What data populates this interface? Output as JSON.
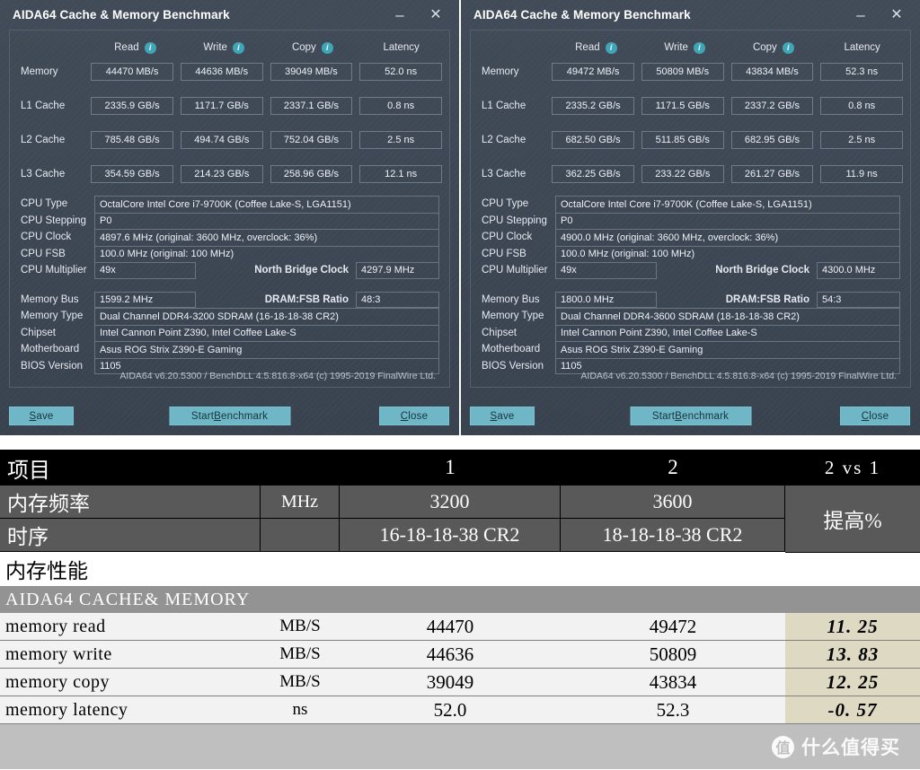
{
  "windows": [
    {
      "title": "AIDA64 Cache & Memory Benchmark",
      "minimize": "–",
      "close": "✕",
      "columns": [
        "Read",
        "Write",
        "Copy",
        "Latency"
      ],
      "rows": [
        {
          "label": "Memory",
          "read": "44470 MB/s",
          "write": "44636 MB/s",
          "copy": "39049 MB/s",
          "latency": "52.0 ns"
        },
        {
          "label": "L1 Cache",
          "read": "2335.9 GB/s",
          "write": "1171.7 GB/s",
          "copy": "2337.1 GB/s",
          "latency": "0.8 ns"
        },
        {
          "label": "L2 Cache",
          "read": "785.48 GB/s",
          "write": "494.74 GB/s",
          "copy": "752.04 GB/s",
          "latency": "2.5 ns"
        },
        {
          "label": "L3 Cache",
          "read": "354.59 GB/s",
          "write": "214.23 GB/s",
          "copy": "258.96 GB/s",
          "latency": "12.1 ns"
        }
      ],
      "info": {
        "cpu_type_label": "CPU Type",
        "cpu_type_value": "OctalCore Intel Core i7-9700K  (Coffee Lake-S, LGA1151)",
        "cpu_stepping_label": "CPU Stepping",
        "cpu_stepping_value": "P0",
        "cpu_clock_label": "CPU Clock",
        "cpu_clock_value": "4897.6 MHz  (original: 3600 MHz, overclock: 36%)",
        "cpu_fsb_label": "CPU FSB",
        "cpu_fsb_value": "100.0 MHz  (original: 100 MHz)",
        "cpu_multiplier_label": "CPU Multiplier",
        "cpu_multiplier_value": "49x",
        "north_bridge_label": "North Bridge Clock",
        "north_bridge_value": "4297.9 MHz",
        "memory_bus_label": "Memory Bus",
        "memory_bus_value": "1599.2 MHz",
        "dram_fsb_label": "DRAM:FSB Ratio",
        "dram_fsb_value": "48:3",
        "memory_type_label": "Memory Type",
        "memory_type_value": "Dual Channel DDR4-3200 SDRAM  (16-18-18-38 CR2)",
        "chipset_label": "Chipset",
        "chipset_value": "Intel Cannon Point Z390, Intel Coffee Lake-S",
        "motherboard_label": "Motherboard",
        "motherboard_value": "Asus ROG Strix Z390-E Gaming",
        "bios_label": "BIOS Version",
        "bios_value": "1105"
      },
      "footer": "AIDA64 v6.20.5300 / BenchDLL 4.5.816.8-x64  (c) 1995-2019 FinalWire Ltd.",
      "buttons": {
        "save_a": "S",
        "save_b": "ave",
        "start_a": "Start ",
        "start_b": "B",
        "start_c": "enchmark",
        "close_a": "C",
        "close_b": "lose"
      }
    },
    {
      "title": "AIDA64 Cache & Memory Benchmark",
      "minimize": "–",
      "close": "✕",
      "columns": [
        "Read",
        "Write",
        "Copy",
        "Latency"
      ],
      "rows": [
        {
          "label": "Memory",
          "read": "49472 MB/s",
          "write": "50809 MB/s",
          "copy": "43834 MB/s",
          "latency": "52.3 ns"
        },
        {
          "label": "L1 Cache",
          "read": "2335.2 GB/s",
          "write": "1171.5 GB/s",
          "copy": "2337.2 GB/s",
          "latency": "0.8 ns"
        },
        {
          "label": "L2 Cache",
          "read": "682.50 GB/s",
          "write": "511.85 GB/s",
          "copy": "682.95 GB/s",
          "latency": "2.5 ns"
        },
        {
          "label": "L3 Cache",
          "read": "362.25 GB/s",
          "write": "233.22 GB/s",
          "copy": "261.27 GB/s",
          "latency": "11.9 ns"
        }
      ],
      "info": {
        "cpu_type_label": "CPU Type",
        "cpu_type_value": "OctalCore Intel Core i7-9700K  (Coffee Lake-S, LGA1151)",
        "cpu_stepping_label": "CPU Stepping",
        "cpu_stepping_value": "P0",
        "cpu_clock_label": "CPU Clock",
        "cpu_clock_value": "4900.0 MHz  (original: 3600 MHz, overclock: 36%)",
        "cpu_fsb_label": "CPU FSB",
        "cpu_fsb_value": "100.0 MHz  (original: 100 MHz)",
        "cpu_multiplier_label": "CPU Multiplier",
        "cpu_multiplier_value": "49x",
        "north_bridge_label": "North Bridge Clock",
        "north_bridge_value": "4300.0 MHz",
        "memory_bus_label": "Memory Bus",
        "memory_bus_value": "1800.0 MHz",
        "dram_fsb_label": "DRAM:FSB Ratio",
        "dram_fsb_value": "54:3",
        "memory_type_label": "Memory Type",
        "memory_type_value": "Dual Channel DDR4-3600 SDRAM  (18-18-18-38 CR2)",
        "chipset_label": "Chipset",
        "chipset_value": "Intel Cannon Point Z390, Intel Coffee Lake-S",
        "motherboard_label": "Motherboard",
        "motherboard_value": "Asus ROG Strix Z390-E Gaming",
        "bios_label": "BIOS Version",
        "bios_value": "1105"
      },
      "footer": "AIDA64 v6.20.5300 / BenchDLL 4.5.816.8-x64  (c) 1995-2019 FinalWire Ltd.",
      "buttons": {
        "save_a": "S",
        "save_b": "ave",
        "start_a": "Start ",
        "start_b": "B",
        "start_c": "enchmark",
        "close_a": "C",
        "close_b": "lose"
      }
    }
  ],
  "comparison": {
    "header": {
      "item": "项目",
      "unit": "",
      "col1": "1",
      "col2": "2",
      "delta": "2 vs 1"
    },
    "spec_rows": [
      {
        "label": "内存频率",
        "unit": "MHz",
        "v1": "3200",
        "v2": "3600"
      },
      {
        "label": "时序",
        "unit": "",
        "v1": "16-18-18-38 CR2",
        "v2": "18-18-18-38 CR2"
      }
    ],
    "delta_label": "提高%",
    "section_title": "内存性能",
    "group_title": "AIDA64 CACHE& MEMORY",
    "data_rows": [
      {
        "label": "memory read",
        "unit": "MB/S",
        "v1": "44470",
        "v2": "49472",
        "delta": "11. 25"
      },
      {
        "label": "memory write",
        "unit": "MB/S",
        "v1": "44636",
        "v2": "50809",
        "delta": "13. 83"
      },
      {
        "label": "memory copy",
        "unit": "MB/S",
        "v1": "39049",
        "v2": "43834",
        "delta": "12. 25"
      },
      {
        "label": "memory latency",
        "unit": "ns",
        "v1": "52.0",
        "v2": "52.3",
        "delta": "-0. 57"
      }
    ]
  },
  "watermark": {
    "logo": "值",
    "text": "什么值得买"
  },
  "colors": {
    "window_bg": "#3d4754",
    "accent_teal": "#6fb7c6",
    "info_icon": "#3fa6b8",
    "header_black": "#000000",
    "spec_gray": "#595959",
    "group_gray": "#939393",
    "data_row_bg": "#f2f2f2",
    "delta_bg": "#ddd9c3",
    "bottom_bar": "#bfbfbf"
  }
}
